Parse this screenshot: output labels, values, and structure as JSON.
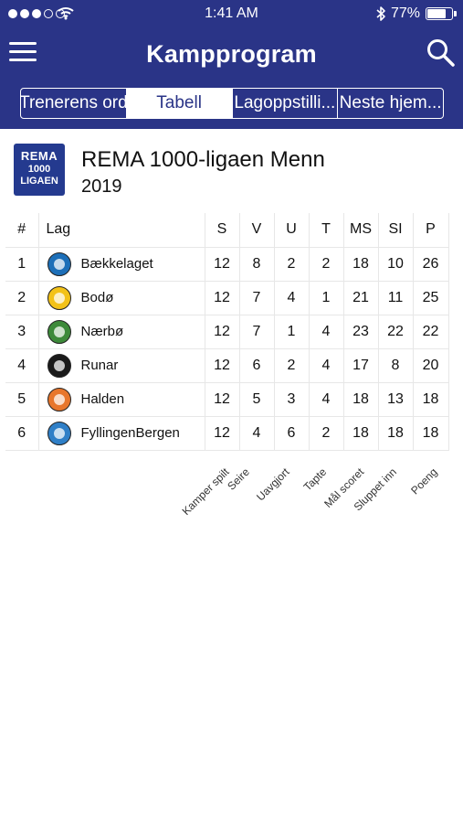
{
  "status_bar": {
    "time": "1:41 AM",
    "battery_percent": "77%",
    "battery_level": 0.77,
    "signal_bars": 3
  },
  "app_bar": {
    "title": "Kampprogram",
    "menu_icon": "hamburger-menu-icon",
    "search_icon": "search-icon"
  },
  "tabs": [
    {
      "label": "Trenerens ord",
      "active": false
    },
    {
      "label": "Tabell",
      "active": true
    },
    {
      "label": "Lagoppstilli...",
      "active": false
    },
    {
      "label": "Neste hjem...",
      "active": false
    }
  ],
  "league": {
    "logo_text": [
      "REMA",
      "1000",
      "LIGAEN"
    ],
    "name": "REMA 1000-ligaen Menn",
    "season": "2019"
  },
  "table": {
    "headers": {
      "rank": "#",
      "team": "Lag",
      "played": "S",
      "won": "V",
      "drawn": "U",
      "lost": "T",
      "goals_for": "MS",
      "goals_against": "SI",
      "points": "P"
    },
    "rows": [
      {
        "rank": "1",
        "team": "Bækkelaget",
        "played": "12",
        "won": "8",
        "drawn": "2",
        "lost": "2",
        "goals_for": "18",
        "goals_against": "10",
        "points": "26",
        "crest_icon": "baekkelaget-crest-icon",
        "crest_color": "#1d6fb8"
      },
      {
        "rank": "2",
        "team": "Bodø",
        "played": "12",
        "won": "7",
        "drawn": "4",
        "lost": "1",
        "goals_for": "21",
        "goals_against": "11",
        "points": "25",
        "crest_icon": "bodo-crest-icon",
        "crest_color": "#f3c218"
      },
      {
        "rank": "3",
        "team": "Nærbø",
        "played": "12",
        "won": "7",
        "drawn": "1",
        "lost": "4",
        "goals_for": "23",
        "goals_against": "22",
        "points": "22",
        "crest_icon": "naerbo-crest-icon",
        "crest_color": "#3d8a3a"
      },
      {
        "rank": "4",
        "team": "Runar",
        "played": "12",
        "won": "6",
        "drawn": "2",
        "lost": "4",
        "goals_for": "17",
        "goals_against": "8",
        "points": "20",
        "crest_icon": "runar-crest-icon",
        "crest_color": "#1a1a1a"
      },
      {
        "rank": "5",
        "team": "Halden",
        "played": "12",
        "won": "5",
        "drawn": "3",
        "lost": "4",
        "goals_for": "18",
        "goals_against": "13",
        "points": "18",
        "crest_icon": "halden-crest-icon",
        "crest_color": "#e8762b"
      },
      {
        "rank": "6",
        "team": "FyllingenBergen",
        "played": "12",
        "won": "4",
        "drawn": "6",
        "lost": "2",
        "goals_for": "18",
        "goals_against": "18",
        "points": "18",
        "crest_icon": "fyllingen-crest-icon",
        "crest_color": "#2f7fc7"
      }
    ],
    "column_descriptions": {
      "played": "Kamper spilt",
      "won": "Seire",
      "drawn": "Uavgjort",
      "lost": "Tapte",
      "goals_for": "Mål scoret",
      "goals_against": "Sluppet inn",
      "points": "Poeng"
    }
  },
  "colors": {
    "header_bg": "#2a3487",
    "header_text": "#ffffff",
    "active_tab_bg": "#ffffff",
    "active_tab_text": "#2a3487"
  }
}
